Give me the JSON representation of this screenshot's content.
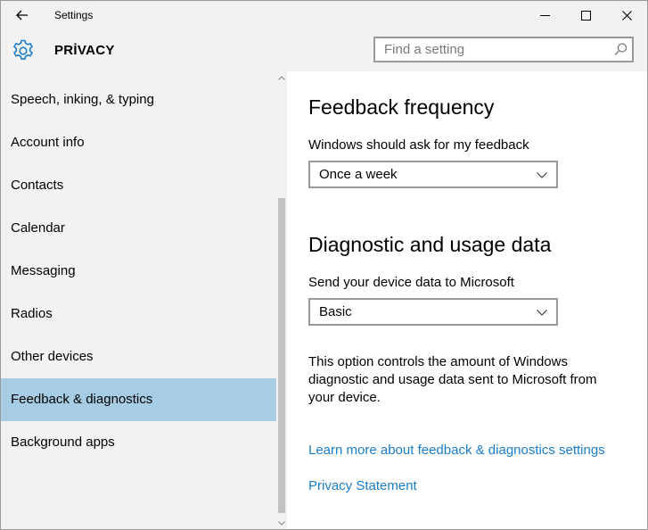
{
  "window": {
    "app_title": "Settings"
  },
  "header": {
    "section_title": "PRİVACY",
    "search_placeholder": "Find a setting"
  },
  "icons": {
    "back": "back-arrow-icon",
    "minimize": "minimize-icon",
    "maximize": "maximize-icon",
    "close": "close-icon",
    "settings": "gear-icon",
    "search": "search-icon",
    "dropdown": "chevron-down-icon"
  },
  "sidebar": {
    "items": [
      {
        "label": "Speech, inking, & typing",
        "selected": false
      },
      {
        "label": "Account info",
        "selected": false
      },
      {
        "label": "Contacts",
        "selected": false
      },
      {
        "label": "Calendar",
        "selected": false
      },
      {
        "label": "Messaging",
        "selected": false
      },
      {
        "label": "Radios",
        "selected": false
      },
      {
        "label": "Other devices",
        "selected": false
      },
      {
        "label": "Feedback & diagnostics",
        "selected": true
      },
      {
        "label": "Background apps",
        "selected": false
      }
    ]
  },
  "main": {
    "feedback": {
      "heading": "Feedback frequency",
      "label": "Windows should ask for my feedback",
      "value": "Once a week"
    },
    "diagnostic": {
      "heading": "Diagnostic and usage data",
      "label": "Send your device data to Microsoft",
      "value": "Basic",
      "description": "This option controls the amount of Windows diagnostic and usage data sent to Microsoft from your device."
    },
    "links": {
      "learn_more": "Learn more about feedback & diagnostics settings",
      "privacy_statement": "Privacy Statement"
    }
  },
  "colors": {
    "selected_nav": "#a6cde4",
    "link": "#1a7dc7",
    "chrome_bg": "#f2f2f2",
    "accent_icon": "#1e7fcd"
  }
}
